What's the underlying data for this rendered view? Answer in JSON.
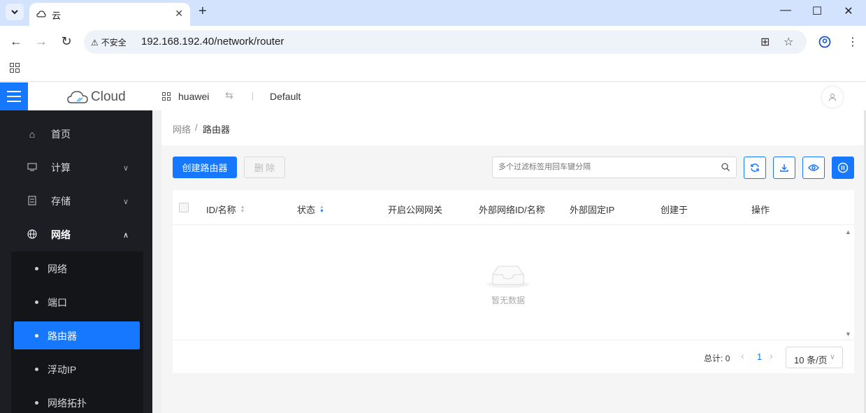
{
  "browser": {
    "tab_title": "云",
    "url": "192.168.192.40/network/router",
    "security_label": "不安全",
    "accent": "#1677ff"
  },
  "header": {
    "logo_text": "Cloud",
    "domain": "huawei",
    "project": "Default"
  },
  "sidebar": {
    "items": [
      {
        "label": "首页",
        "icon": "home-icon"
      },
      {
        "label": "计算",
        "icon": "monitor-icon"
      },
      {
        "label": "存储",
        "icon": "storage-icon"
      },
      {
        "label": "网络",
        "icon": "globe-icon"
      }
    ],
    "sub_items": [
      {
        "label": "网络"
      },
      {
        "label": "端口"
      },
      {
        "label": "路由器",
        "active": true
      },
      {
        "label": "浮动IP"
      },
      {
        "label": "网络拓扑"
      }
    ]
  },
  "breadcrumb": {
    "parent": "网络",
    "separator": "/",
    "current": "路由器"
  },
  "toolbar": {
    "create_label": "创建路由器",
    "delete_label": "删 除",
    "search_placeholder": "多个过滤标签用回车键分隔"
  },
  "table": {
    "columns": [
      "ID/名称",
      "状态",
      "开启公网网关",
      "外部网络ID/名称",
      "外部固定IP",
      "创建于",
      "操作"
    ],
    "empty_text": "暂无数据"
  },
  "pagination": {
    "total_label": "总计:",
    "total": "0",
    "current_page": "1",
    "page_size": "10 条/页"
  }
}
